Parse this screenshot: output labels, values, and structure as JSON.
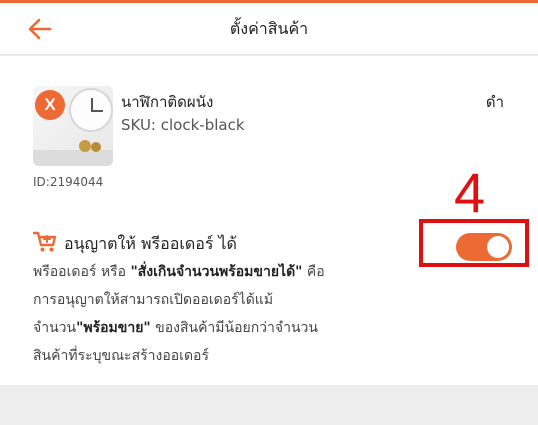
{
  "header": {
    "title": "ตั้งค่าสินค้า"
  },
  "product": {
    "name": "นาฬิกาติดผนัง",
    "sku": "SKU: clock-black",
    "color": "ดำ",
    "id": "ID:2194044",
    "thumb_badge": "X"
  },
  "annotation": {
    "number": "4"
  },
  "preorder": {
    "title": "อนุญาตให้ พรีออเดอร์ ได้",
    "enabled": true,
    "description": {
      "l1_a": "พรีออเดอร์ หรือ ",
      "l1_b": "\"สั่งเกินจำนวนพร้อมขายได้\"",
      "l1_c": " คือ",
      "l2": "การอนุญาตให้สามารถเปิดออเดอร์ได้แม้",
      "l3_a": "จำนวน",
      "l3_b": "\"พร้อมขาย\"",
      "l3_c": " ของสินค้ามีน้อยกว่าจำนวน",
      "l4": "สินค้าที่ระบุขณะสร้างออเดอร์"
    }
  },
  "colors": {
    "accent": "#ee6a34",
    "annotation": "#e01010"
  },
  "icons": [
    "arrow-left-icon",
    "cart-icon"
  ]
}
